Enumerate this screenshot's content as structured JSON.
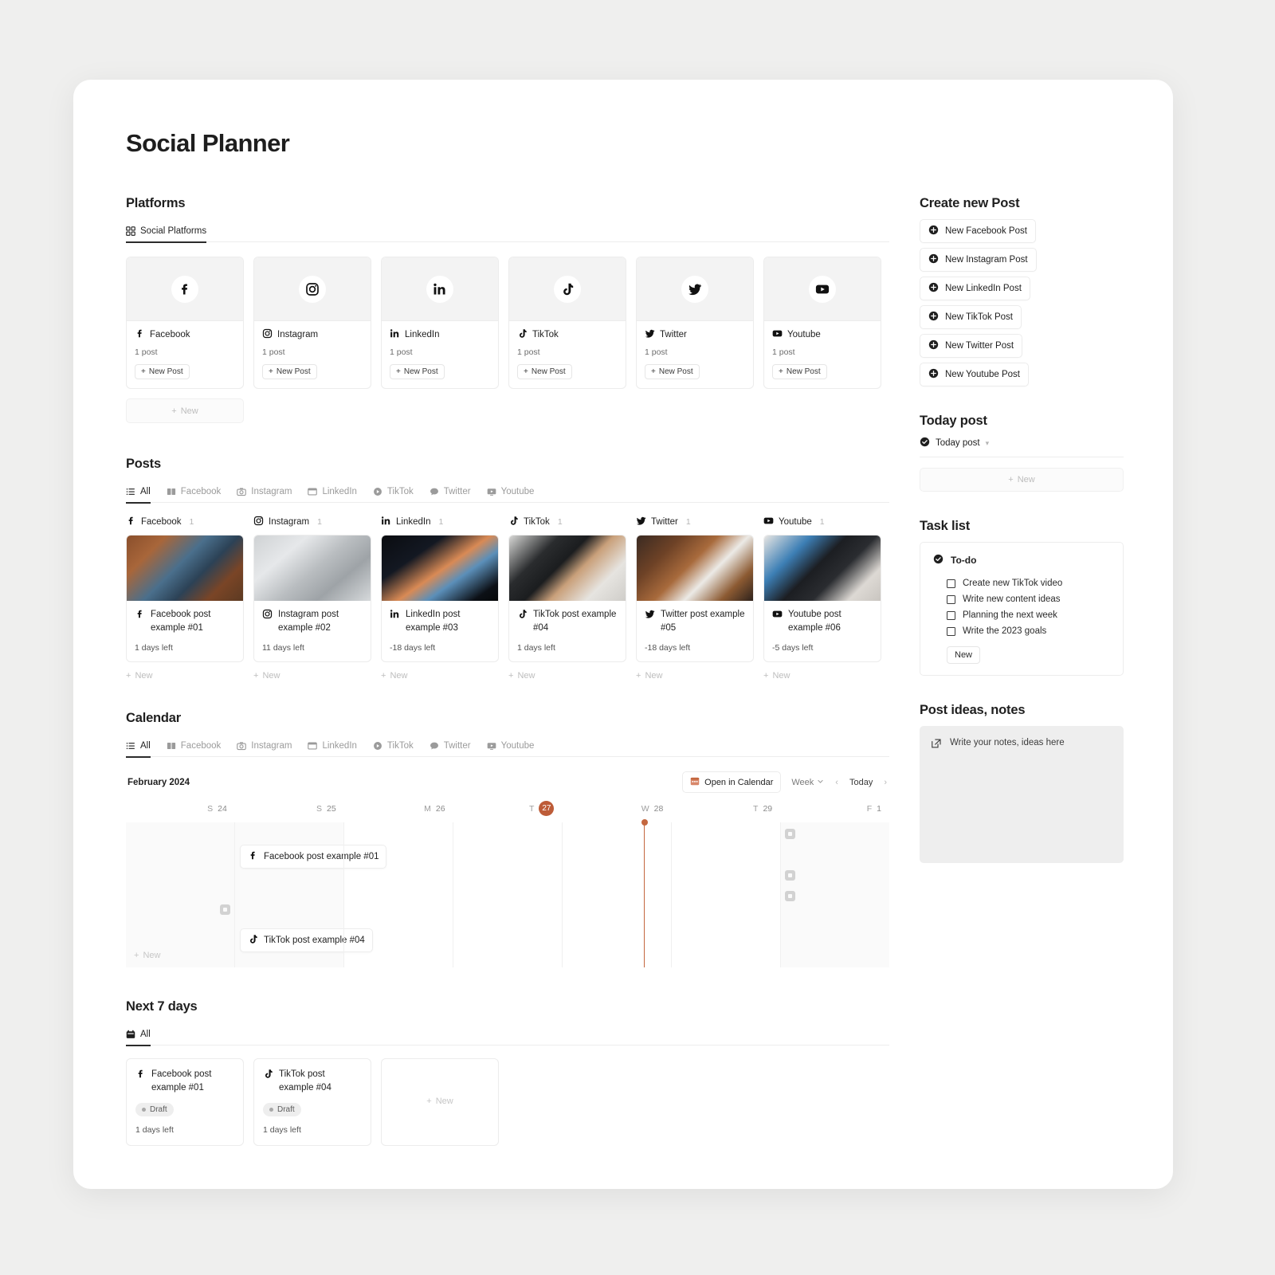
{
  "app": {
    "title": "Social Planner"
  },
  "platforms": {
    "heading": "Platforms",
    "tab": {
      "label": "Social Platforms",
      "icon": "grid-icon"
    },
    "add_new_label": "New",
    "items": [
      {
        "name": "Facebook",
        "icon": "facebook-icon",
        "count": "1 post",
        "new_post": "New Post"
      },
      {
        "name": "Instagram",
        "icon": "instagram-icon",
        "count": "1 post",
        "new_post": "New Post"
      },
      {
        "name": "LinkedIn",
        "icon": "linkedin-icon",
        "count": "1 post",
        "new_post": "New Post"
      },
      {
        "name": "TikTok",
        "icon": "tiktok-icon",
        "count": "1 post",
        "new_post": "New Post"
      },
      {
        "name": "Twitter",
        "icon": "twitter-icon",
        "count": "1 post",
        "new_post": "New Post"
      },
      {
        "name": "Youtube",
        "icon": "youtube-icon",
        "count": "1 post",
        "new_post": "New Post"
      }
    ]
  },
  "posts": {
    "heading": "Posts",
    "tabs": [
      {
        "label": "All",
        "icon": "list-icon",
        "active": true
      },
      {
        "label": "Facebook",
        "icon": "book-icon",
        "active": false
      },
      {
        "label": "Instagram",
        "icon": "camera-icon",
        "active": false
      },
      {
        "label": "LinkedIn",
        "icon": "window-icon",
        "active": false
      },
      {
        "label": "TikTok",
        "icon": "play-icon",
        "active": false
      },
      {
        "label": "Twitter",
        "icon": "chat-icon",
        "active": false
      },
      {
        "label": "Youtube",
        "icon": "screen-icon",
        "active": false
      }
    ],
    "new_label": "New",
    "columns": [
      {
        "platform": "Facebook",
        "icon": "facebook-icon",
        "count": "1",
        "card": {
          "title": "Facebook post example #01",
          "days_left": "1 days left",
          "thumb": "laptop-wood-desk"
        }
      },
      {
        "platform": "Instagram",
        "icon": "instagram-icon",
        "count": "1",
        "card": {
          "title": "Instagram post example #02",
          "days_left": "11 days left",
          "thumb": "silver-macbook"
        }
      },
      {
        "platform": "LinkedIn",
        "icon": "linkedin-icon",
        "count": "1",
        "card": {
          "title": "LinkedIn post example #03",
          "days_left": "-18 days left",
          "thumb": "dark-laptop-glow"
        }
      },
      {
        "platform": "TikTok",
        "icon": "tiktok-icon",
        "count": "1",
        "card": {
          "title": "TikTok post example #04",
          "days_left": "1 days left",
          "thumb": "laptop-coffee"
        }
      },
      {
        "platform": "Twitter",
        "icon": "twitter-icon",
        "count": "1",
        "card": {
          "title": "Twitter post example #05",
          "days_left": "-18 days left",
          "thumb": "wood-desk-mockup"
        }
      },
      {
        "platform": "Youtube",
        "icon": "youtube-icon",
        "count": "1",
        "card": {
          "title": "Youtube post example #06",
          "days_left": "-5 days left",
          "thumb": "monitor-workspace"
        }
      }
    ]
  },
  "calendar": {
    "heading": "Calendar",
    "tabs": [
      {
        "label": "All",
        "icon": "list-icon",
        "active": true
      },
      {
        "label": "Facebook",
        "icon": "book-icon",
        "active": false
      },
      {
        "label": "Instagram",
        "icon": "camera-icon",
        "active": false
      },
      {
        "label": "LinkedIn",
        "icon": "window-icon",
        "active": false
      },
      {
        "label": "TikTok",
        "icon": "play-icon",
        "active": false
      },
      {
        "label": "Twitter",
        "icon": "chat-icon",
        "active": false
      },
      {
        "label": "Youtube",
        "icon": "screen-icon",
        "active": false
      }
    ],
    "month": "February 2024",
    "open_in_calendar": "Open in Calendar",
    "view_mode": "Week",
    "prev_label": "‹",
    "today_label": "Today",
    "next_label": "›",
    "new_label": "New",
    "today_accent": "#bd5c38",
    "days": [
      {
        "dow": "S",
        "date": "24",
        "today": false
      },
      {
        "dow": "S",
        "date": "25",
        "today": false
      },
      {
        "dow": "M",
        "date": "26",
        "today": false
      },
      {
        "dow": "T",
        "date": "27",
        "today": true
      },
      {
        "dow": "W",
        "date": "28",
        "today": false
      },
      {
        "dow": "T",
        "date": "29",
        "today": false
      },
      {
        "dow": "F",
        "date": "1",
        "today": false
      }
    ],
    "events": [
      {
        "title": "Facebook post example #01",
        "icon": "facebook-icon"
      },
      {
        "title": "TikTok post example #04",
        "icon": "tiktok-icon"
      }
    ]
  },
  "next7": {
    "heading": "Next 7 days",
    "tab": {
      "label": "All",
      "icon": "calendar-icon"
    },
    "new_label": "New",
    "cards": [
      {
        "title": "Facebook post example #01",
        "icon": "facebook-icon",
        "status": "Draft",
        "days_left": "1 days left"
      },
      {
        "title": "TikTok post example #04",
        "icon": "tiktok-icon",
        "status": "Draft",
        "days_left": "1 days left"
      }
    ]
  },
  "side": {
    "create": {
      "heading": "Create new Post",
      "buttons": [
        {
          "label": "New Facebook Post",
          "icon": "plus-circle-icon"
        },
        {
          "label": "New Instagram Post",
          "icon": "plus-circle-icon"
        },
        {
          "label": "New LinkedIn Post",
          "icon": "plus-circle-icon"
        },
        {
          "label": "New TikTok Post",
          "icon": "plus-circle-icon"
        },
        {
          "label": "New Twitter Post",
          "icon": "plus-circle-icon"
        },
        {
          "label": "New Youtube Post",
          "icon": "plus-circle-icon"
        }
      ]
    },
    "today": {
      "heading": "Today post",
      "group_label": "Today post",
      "new_label": "New"
    },
    "tasks": {
      "heading": "Task list",
      "group_label": "To-do",
      "items": [
        {
          "label": "Create new TikTok video",
          "checked": false
        },
        {
          "label": "Write new content ideas",
          "checked": false
        },
        {
          "label": "Planning the next week",
          "checked": false
        },
        {
          "label": "Write the 2023 goals",
          "checked": false
        }
      ],
      "new_label": "New"
    },
    "notes": {
      "heading": "Post ideas, notes",
      "placeholder": "Write your notes, ideas here"
    }
  }
}
